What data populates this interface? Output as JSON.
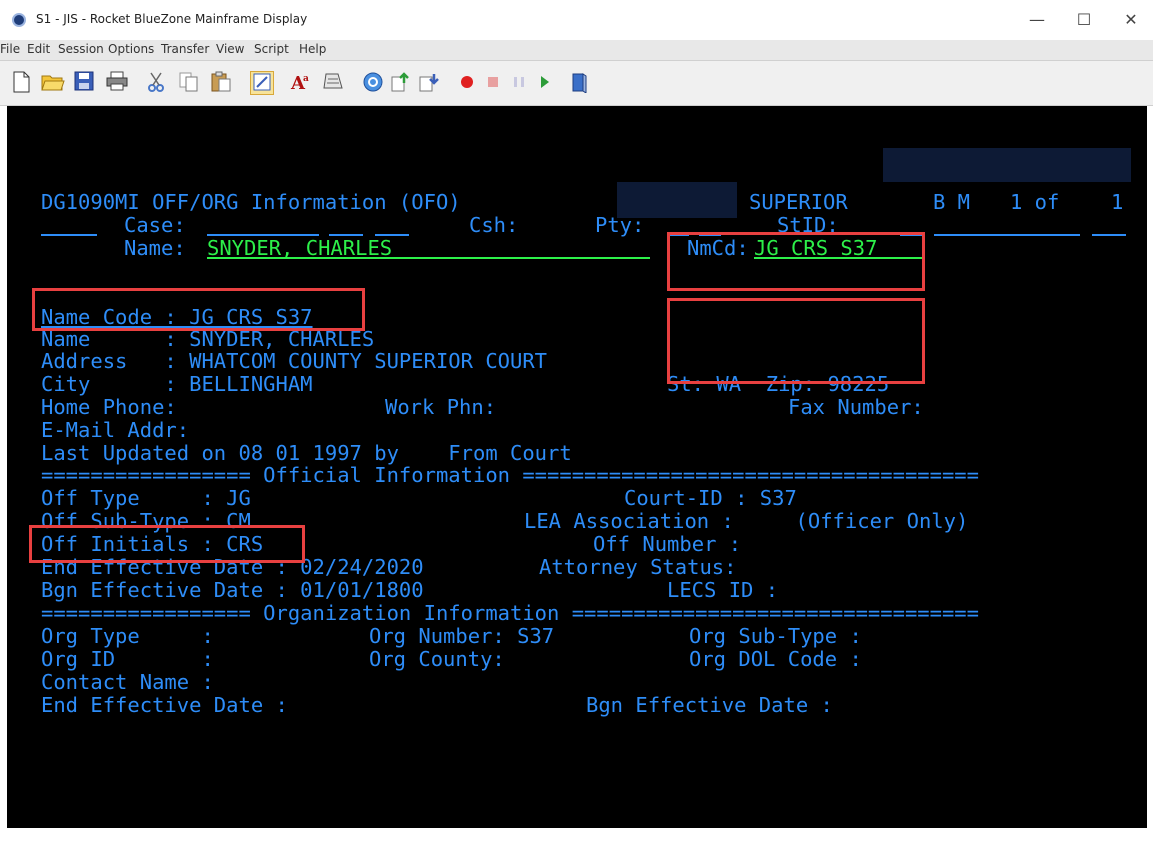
{
  "window": {
    "title": "S1 - JIS - Rocket BlueZone Mainframe Display",
    "controls": {
      "minimize": "—",
      "maximize": "☐",
      "close": "✕"
    }
  },
  "menu": [
    "File",
    "Edit",
    "Session",
    "Options",
    "Transfer",
    "View",
    "Script",
    "Help"
  ],
  "toolbar": {
    "icons": [
      "new-document-icon",
      "open-folder-icon",
      "save-icon",
      "print-icon",
      "cut-icon",
      "copy-icon",
      "paste-icon",
      "edit-session-icon",
      "font-icon",
      "keyboard-icon",
      "web-icon",
      "send-file-icon",
      "receive-file-icon",
      "record-icon",
      "stop-icon",
      "pause-icon",
      "play-icon",
      "script-book-icon"
    ]
  },
  "screen": {
    "r1": {
      "screen_id": "DG1090MI OFF/ORG Information (OFO)",
      "court": "SUPERIOR",
      "flags": "B M",
      "page": "1 of",
      "total": "1"
    },
    "r2": {
      "case_label": "Case:",
      "csh_label": "Csh:",
      "pty_label": "Pty:",
      "stid_label": "StID:"
    },
    "r3": {
      "name_label": "Name:",
      "name_value": "SNYDER, CHARLES",
      "nmcd_label": "NmCd:",
      "nmcd_value": "JG CRS S37"
    },
    "name_code": "Name Code : JG CRS S37",
    "name": "Name      : SNYDER, CHARLES",
    "address": "Address   : WHATCOM COUNTY SUPERIOR COURT",
    "city": "City      : BELLINGHAM",
    "st_zip": "St: WA  Zip: 98225",
    "home_phone": "Home Phone:",
    "work_phone": "Work Phn:",
    "fax": "Fax Number:",
    "email": "E-Mail Addr:",
    "last_updated": "Last Updated on 08 01 1997 by    From Court",
    "official_sep": "================= Official Information =====================================",
    "off_type": "Off Type     : JG",
    "court_id": "Court-ID : S37",
    "off_subtype": "Off Sub-Type : CM",
    "lea_assoc": "LEA Association :     (Officer Only)",
    "off_initials": "Off Initials : CRS",
    "off_number": "Off Number :",
    "end_eff": "End Effective Date : 02/24/2020",
    "atty_status": "Attorney Status:",
    "bgn_eff": "Bgn Effective Date : 01/01/1800",
    "lecs_id": "LECS ID :",
    "org_sep": "================= Organization Information =================================",
    "org_type": "Org Type     :",
    "org_number": "Org Number: S37",
    "org_subtype": "Org Sub-Type :",
    "org_id": "Org ID       :",
    "org_county": "Org County:",
    "org_dol": "Org DOL Code :",
    "contact": "Contact Name :",
    "org_end_eff": "End Effective Date :",
    "org_bgn_eff": "Bgn Effective Date :"
  }
}
